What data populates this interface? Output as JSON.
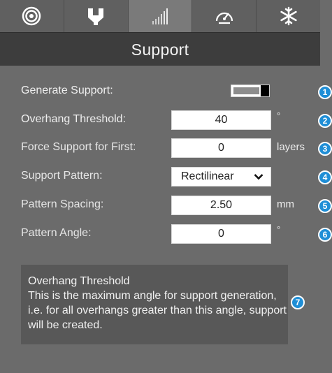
{
  "tabs": [
    {
      "icon": "spiral-icon"
    },
    {
      "icon": "support-icon"
    },
    {
      "icon": "infill-icon"
    },
    {
      "icon": "speedometer-icon"
    },
    {
      "icon": "snowflake-icon"
    }
  ],
  "header": {
    "title": "Support"
  },
  "fields": {
    "generate_support": {
      "label": "Generate Support:",
      "on": true,
      "badge": "1"
    },
    "overhang_threshold": {
      "label": "Overhang Threshold:",
      "value": "40",
      "unit": "°",
      "badge": "2"
    },
    "force_support": {
      "label": "Force Support for First:",
      "value": "0",
      "unit": "layers",
      "badge": "3"
    },
    "support_pattern": {
      "label": "Support Pattern:",
      "value": "Rectilinear",
      "badge": "4"
    },
    "pattern_spacing": {
      "label": "Pattern Spacing:",
      "value": "2.50",
      "unit": "mm",
      "badge": "5"
    },
    "pattern_angle": {
      "label": "Pattern Angle:",
      "value": "0",
      "unit": "°",
      "badge": "6"
    }
  },
  "help": {
    "title": "Overhang Threshold",
    "text": "This is the maximum angle for support generation, i.e. for all overhangs greater than this angle, support will be created.",
    "badge": "7"
  },
  "colors": {
    "badge": "#1f8ed6",
    "title_bar": "#3d3d3d",
    "panel": "#6b6b6b"
  }
}
